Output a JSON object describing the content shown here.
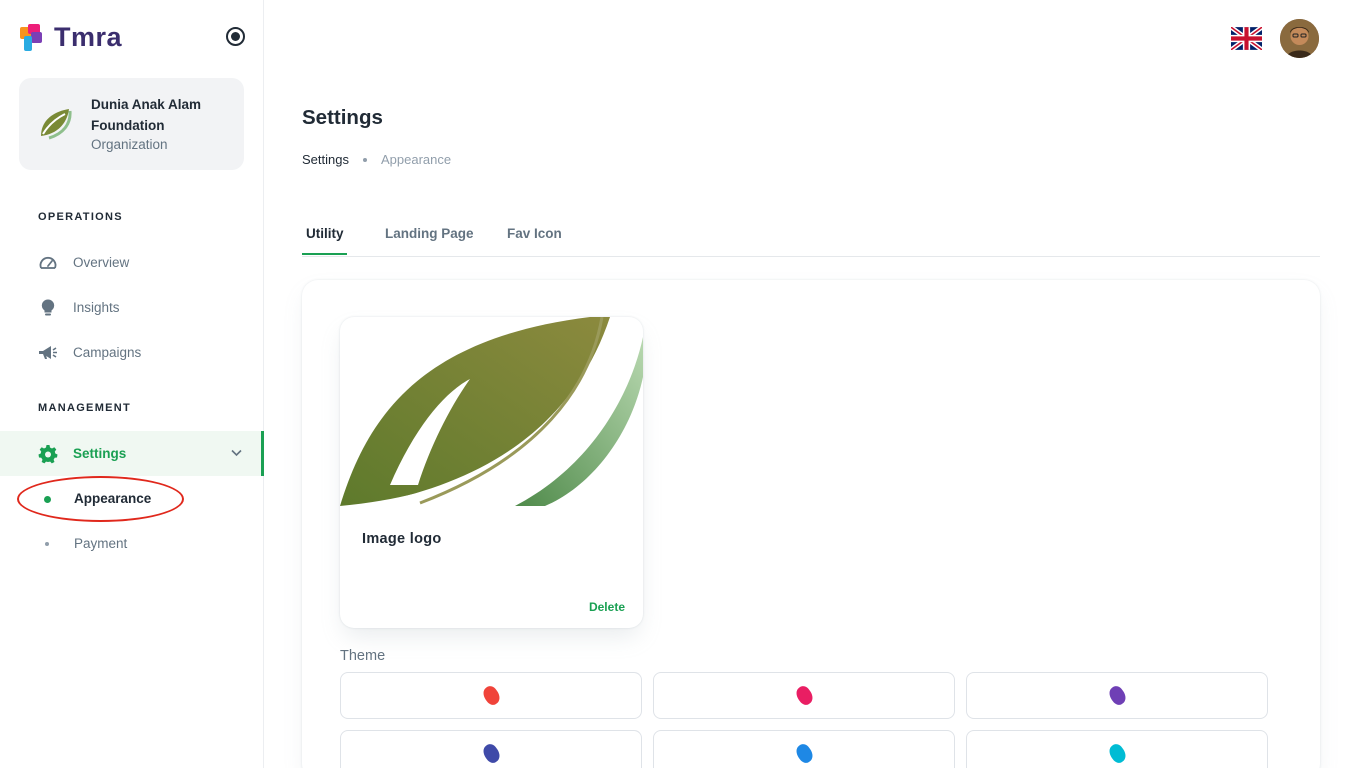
{
  "app": {
    "name": "Tmra"
  },
  "organization": {
    "name": "Dunia Anak Alam Foundation",
    "role": "Organization"
  },
  "sidebar": {
    "sections": {
      "operations": "OPERATIONS",
      "management": "MANAGEMENT"
    },
    "items": {
      "overview": "Overview",
      "insights": "Insights",
      "campaigns": "Campaigns",
      "settings": "Settings"
    },
    "sub_items": {
      "appearance": "Appearance",
      "payment": "Payment"
    }
  },
  "page": {
    "title": "Settings",
    "breadcrumb": [
      "Settings",
      "Appearance"
    ]
  },
  "tabs": [
    "Utility",
    "Landing Page",
    "Fav Icon"
  ],
  "logo_card": {
    "caption": "Image logo",
    "delete_label": "Delete"
  },
  "theme": {
    "label": "Theme",
    "colors": [
      "#f0433a",
      "#e91e63",
      "#6f3fb5",
      "#3f4aa8",
      "#1e88e5",
      "#00bcd4"
    ]
  },
  "colors": {
    "accent": "#1aa053",
    "annotation": "#e0281c"
  }
}
